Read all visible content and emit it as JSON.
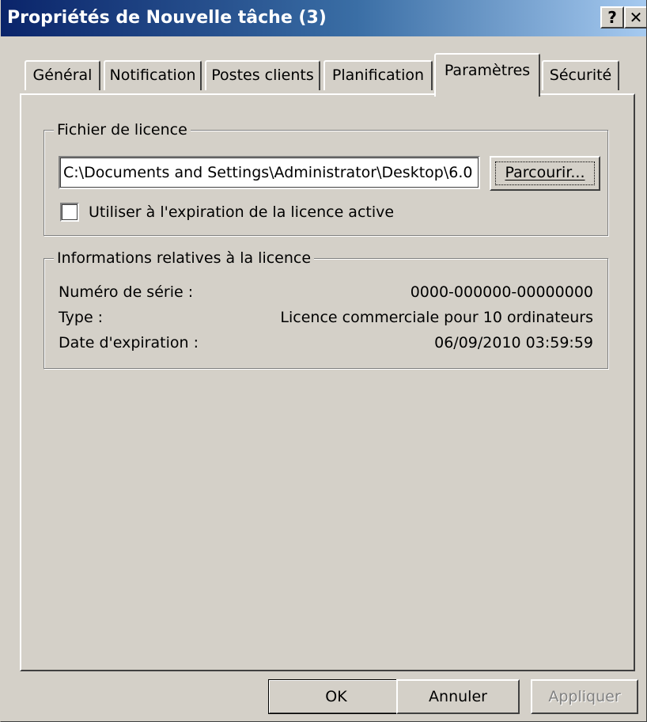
{
  "window": {
    "title": "Propriétés de Nouvelle tâche (3)",
    "help_glyph": "?",
    "close_glyph": "✕"
  },
  "tabs": [
    {
      "label": "Général",
      "active": false
    },
    {
      "label": "Notification",
      "active": false
    },
    {
      "label": "Postes clients",
      "active": false
    },
    {
      "label": "Planification",
      "active": false
    },
    {
      "label": "Paramètres",
      "active": true
    },
    {
      "label": "Sécurité",
      "active": false
    }
  ],
  "license_file": {
    "group_label": "Fichier de licence",
    "path_value": "C:\\Documents and Settings\\Administrator\\Desktop\\6.0",
    "browse_label": "Parcourir...",
    "checkbox_label": "Utiliser à l'expiration de la licence active",
    "checkbox_checked": false
  },
  "license_info": {
    "group_label": "Informations relatives à la licence",
    "rows": [
      {
        "label": "Numéro de série :",
        "value": "0000-000000-00000000"
      },
      {
        "label": "Type :",
        "value": "Licence commerciale pour 10 ordinateurs"
      },
      {
        "label": "Date d'expiration :",
        "value": "06/09/2010 03:59:59"
      }
    ]
  },
  "buttons": {
    "ok_label": "OK",
    "cancel_label": "Annuler",
    "apply_label": "Appliquer",
    "apply_enabled": false
  },
  "colors": {
    "face": "#d4d0c8",
    "title_start": "#0a246a",
    "title_end": "#a6caf0",
    "disabled_text": "#808080"
  }
}
